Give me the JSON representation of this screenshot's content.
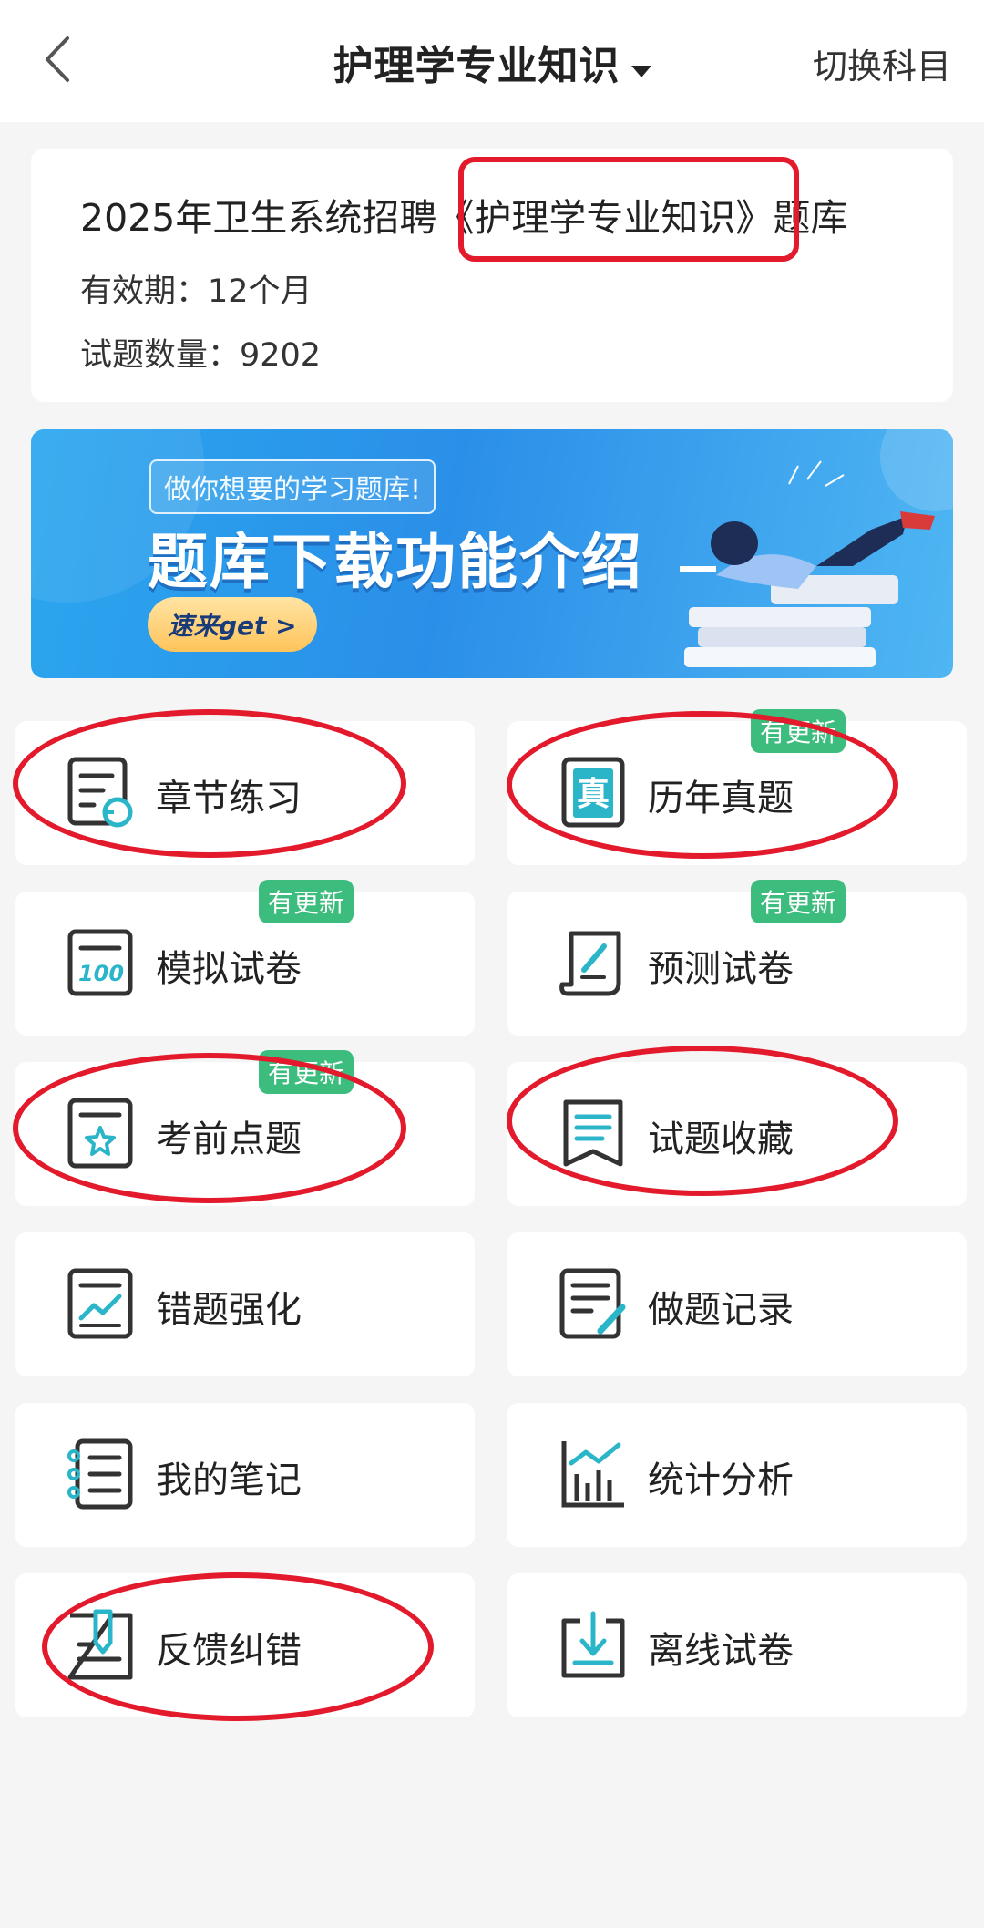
{
  "header": {
    "title": "护理学专业知识",
    "switch_label": "切换科目"
  },
  "info": {
    "title_pre": "2025年卫生系统招聘",
    "title_highlight": "《护理学专业知识》",
    "title_post": "题库",
    "validity": "有效期：12个月",
    "count": "试题数量：9202"
  },
  "banner": {
    "tag": "做你想要的学习题库!",
    "headline": "题库下载功能介绍",
    "cta": "速来get >"
  },
  "menu": [
    {
      "label": "章节练习",
      "badge": "",
      "icon": "chapter-practice-icon"
    },
    {
      "label": "历年真题",
      "badge": "有更新",
      "icon": "past-exam-icon"
    },
    {
      "label": "模拟试卷",
      "badge": "有更新",
      "icon": "mock-exam-icon"
    },
    {
      "label": "预测试卷",
      "badge": "有更新",
      "icon": "forecast-exam-icon"
    },
    {
      "label": "考前点题",
      "badge": "有更新",
      "icon": "key-points-icon"
    },
    {
      "label": "试题收藏",
      "badge": "",
      "icon": "bookmark-icon"
    },
    {
      "label": "错题强化",
      "badge": "",
      "icon": "wrong-answers-icon"
    },
    {
      "label": "做题记录",
      "badge": "",
      "icon": "history-record-icon"
    },
    {
      "label": "我的笔记",
      "badge": "",
      "icon": "notes-icon"
    },
    {
      "label": "统计分析",
      "badge": "",
      "icon": "statistics-icon"
    },
    {
      "label": "反馈纠错",
      "badge": "",
      "icon": "feedback-icon"
    },
    {
      "label": "离线试卷",
      "badge": "",
      "icon": "download-icon"
    }
  ],
  "colors": {
    "accent": "#2bb5c9",
    "badge": "#3dbd7d",
    "annotation": "#e21a2c"
  }
}
